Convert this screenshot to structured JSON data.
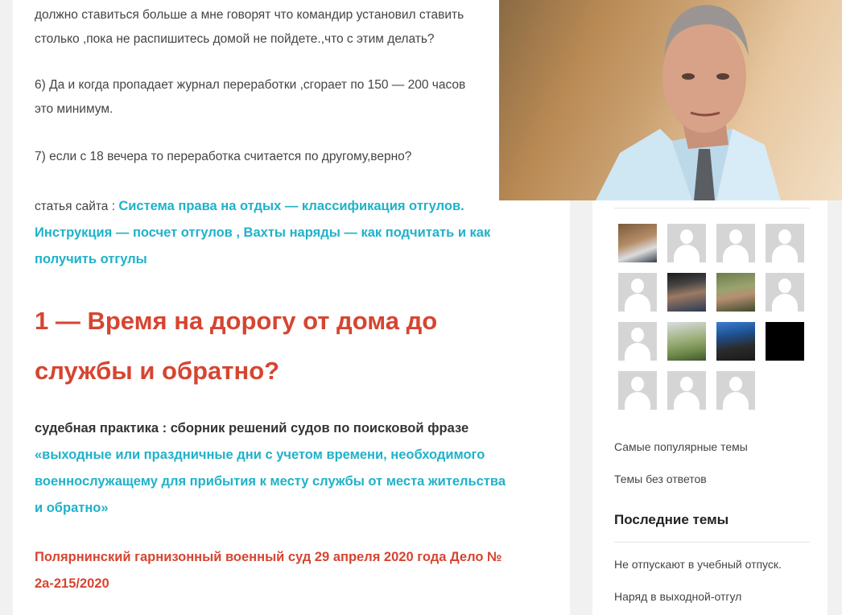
{
  "article": {
    "p1_line1": "должно ставиться больше а мне говорят что командир установил ставить",
    "p1_line2": "столько ,пока не распишитесь домой не пойдете.,что с этим делать?",
    "p6_line1": "6) Да и когда пропадает журнал переработки ,сгорает по 150 — 200 часов",
    "p6_line2": "это минимум.",
    "p7": "7)  если с 18 вечера то переработка считается по другому,верно?",
    "site_article_label": "статья сайта : ",
    "site_article_link_line1": "Система права на отдых — классификация отгулов.",
    "site_article_link_line2": "Инструкция — посчет отгулов , Вахты наряды — как подчитать и как",
    "site_article_link_line3": "получить отгулы",
    "heading_line1": "1 — Время на дорогу от дома до",
    "heading_line2": "службы и обратно?",
    "judicial_label": "судебная практика : сборник решений судов по поисковой фразе",
    "judicial_link_line1": "«выходные или праздничные дни с учетом времени, необходимого",
    "judicial_link_line2": "военнослужащему для прибытия к месту службы от места жительства",
    "judicial_link_line3": "и обратно»",
    "case_title_line1": "Полярнинский гарнизонный военный суд 29 апреля 2020 года Дело №",
    "case_title_line2": "2а-215/2020"
  },
  "sidebar": {
    "avatars": [
      {
        "kind": "photo1"
      },
      {
        "kind": "placeholder"
      },
      {
        "kind": "placeholder"
      },
      {
        "kind": "placeholder"
      },
      {
        "kind": "placeholder"
      },
      {
        "kind": "photo2"
      },
      {
        "kind": "photo3"
      },
      {
        "kind": "placeholder"
      },
      {
        "kind": "placeholder"
      },
      {
        "kind": "photo4"
      },
      {
        "kind": "photo5"
      },
      {
        "kind": "black"
      },
      {
        "kind": "placeholder"
      },
      {
        "kind": "placeholder"
      },
      {
        "kind": "placeholder"
      }
    ],
    "popular_topics": "Самые популярные темы",
    "unanswered_topics": "Темы без ответов",
    "latest_topics_heading": "Последние темы",
    "latest_topics": [
      "Не отпускают в учебный отпуск.",
      "Наряд в выходной-отгул"
    ]
  },
  "colors": {
    "link": "#1fb2c9",
    "heading_red": "#d64531",
    "text": "#444444"
  }
}
